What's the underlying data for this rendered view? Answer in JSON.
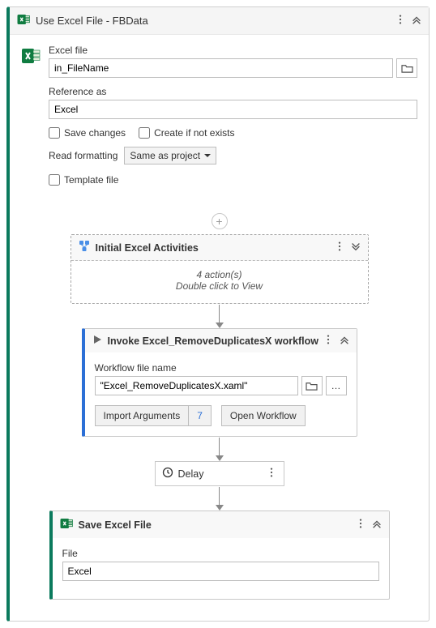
{
  "outer": {
    "title": "Use Excel File - FBData",
    "excelFileLabel": "Excel file",
    "excelFileValue": "in_FileName",
    "referenceAsLabel": "Reference as",
    "referenceAsValue": "Excel",
    "saveChangesLabel": "Save changes",
    "createIfNotExistsLabel": "Create if not exists",
    "readFormattingLabel": "Read formatting",
    "readFormattingValue": "Same as project",
    "templateFileLabel": "Template file"
  },
  "initial": {
    "title": "Initial Excel Activities",
    "line1": "4 action(s)",
    "line2": "Double click to View"
  },
  "invoke": {
    "title": "Invoke Excel_RemoveDuplicatesX workflow",
    "workflowFileLabel": "Workflow file name",
    "workflowFileValue": "\"Excel_RemoveDuplicatesX.xaml\"",
    "importArgsLabel": "Import Arguments",
    "importArgsCount": "7",
    "openWorkflowLabel": "Open Workflow"
  },
  "delay": {
    "title": "Delay"
  },
  "save": {
    "title": "Save Excel File",
    "fileLabel": "File",
    "fileValue": "Excel"
  }
}
